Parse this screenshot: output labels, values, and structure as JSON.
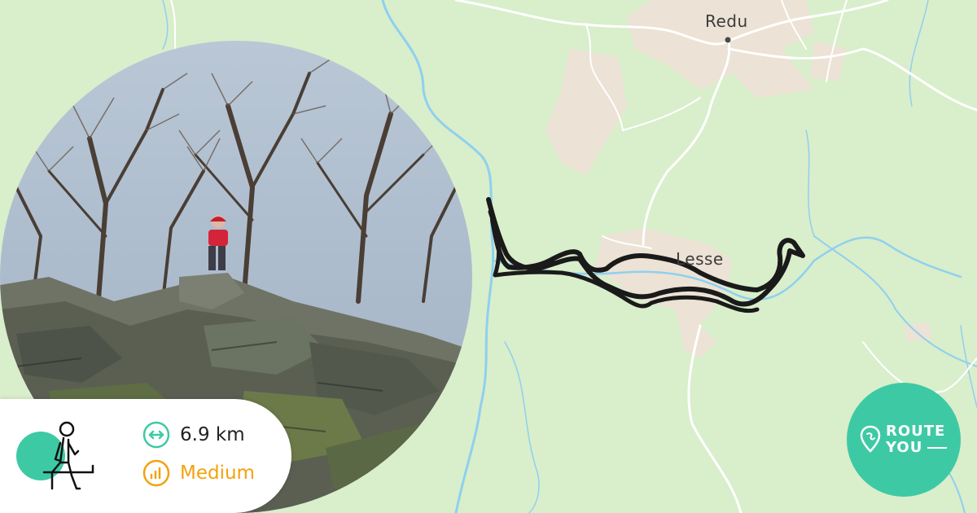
{
  "map": {
    "places": [
      {
        "name": "Redu"
      },
      {
        "name": "Lesse"
      }
    ],
    "colors": {
      "land": "#d9eecb",
      "water": "#8fd0ef",
      "urban": "#ece2d5",
      "road": "#ffffff",
      "route": "#1a1a1a"
    }
  },
  "route": {
    "activity_icon": "hiker-icon",
    "distance": "6.9 km",
    "difficulty": "Medium",
    "accent_color": "#3ec9a5",
    "difficulty_color": "#f2a20f"
  },
  "brand": {
    "line1": "ROUTE",
    "line2": "YOU"
  }
}
